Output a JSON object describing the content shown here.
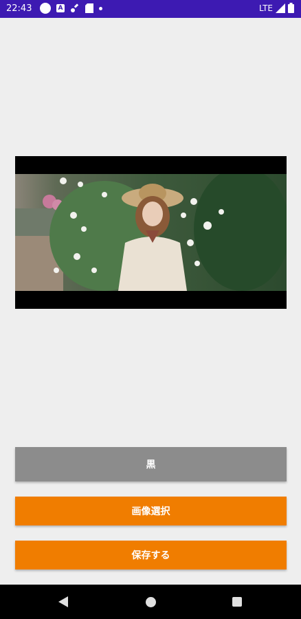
{
  "status_bar": {
    "time": "22:43",
    "network": "LTE",
    "icons": [
      "circle-icon",
      "a-icon",
      "tools-icon",
      "sd-card-icon",
      "dot-icon",
      "signal-icon",
      "battery-icon"
    ]
  },
  "image": {
    "description_icon": "portrait-photo"
  },
  "buttons": {
    "black": "黒",
    "select_image": "画像選択",
    "save": "保存する"
  },
  "nav": {
    "icons": [
      "back-icon",
      "home-icon",
      "recents-icon"
    ]
  },
  "colors": {
    "status_bar": "#3d1ab2",
    "accent_button": "#f07d00",
    "gray_button": "#8c8c8c",
    "background": "#eeeeee"
  }
}
